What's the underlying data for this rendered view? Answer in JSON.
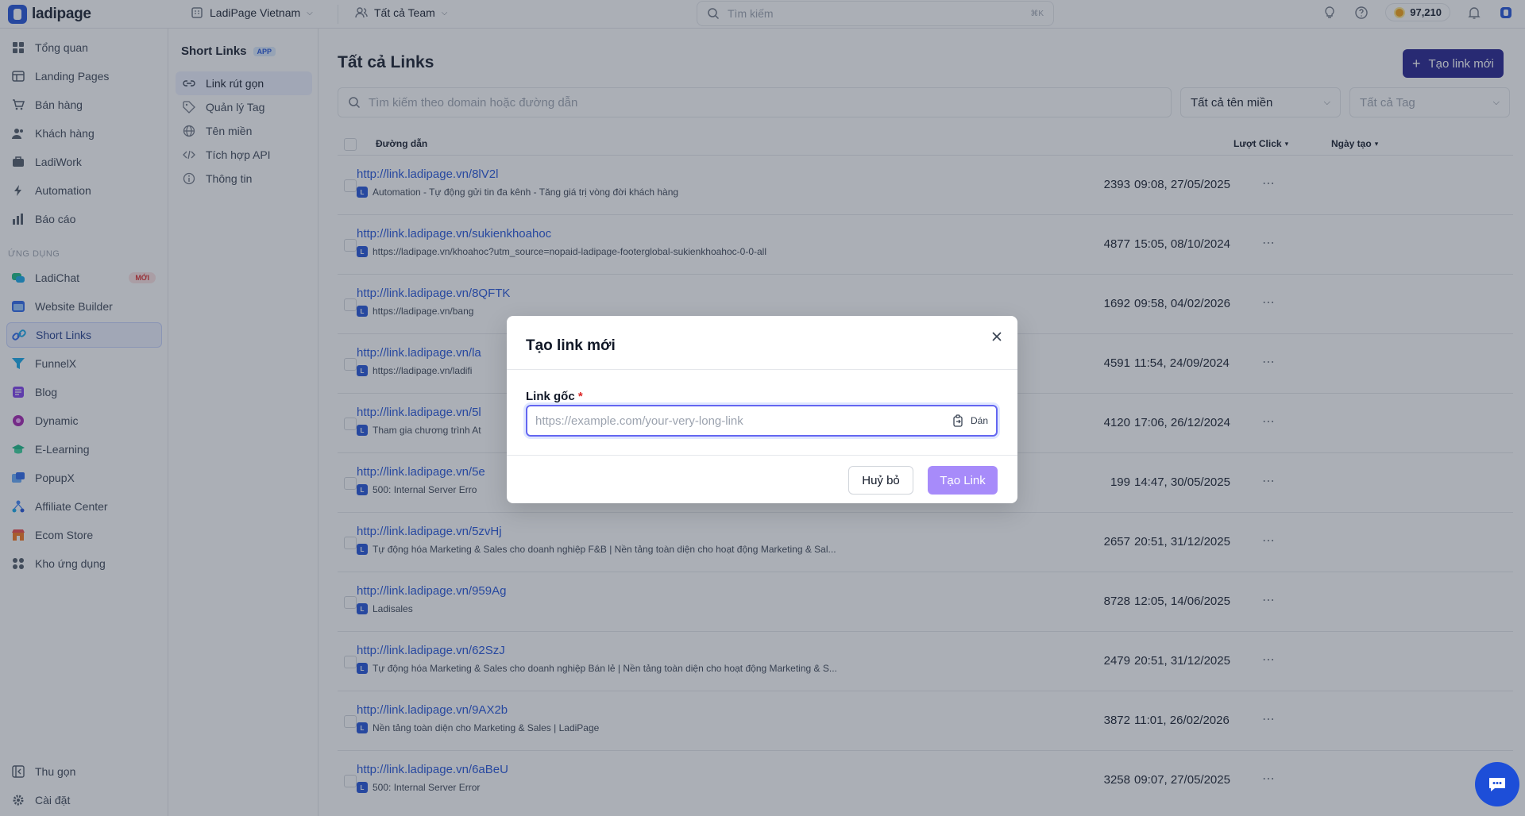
{
  "brand": {
    "name": "ladipage"
  },
  "topbar": {
    "workspace": "LadiPage Vietnam",
    "team": "Tất cả Team",
    "search_placeholder": "Tìm kiếm",
    "search_shortcut": "⌘K",
    "credits": "97,210"
  },
  "sidebar": {
    "items": [
      {
        "label": "Tổng quan",
        "icon": "grid-icon"
      },
      {
        "label": "Landing Pages",
        "icon": "layout-icon"
      },
      {
        "label": "Bán hàng",
        "icon": "cart-icon"
      },
      {
        "label": "Khách hàng",
        "icon": "users-icon"
      },
      {
        "label": "LadiWork",
        "icon": "briefcase-icon"
      },
      {
        "label": "Automation",
        "icon": "bolt-icon"
      },
      {
        "label": "Báo cáo",
        "icon": "bar-chart-icon"
      }
    ],
    "apps_label": "ỨNG DỤNG",
    "apps": [
      {
        "label": "LadiChat",
        "badge": "MỚI"
      },
      {
        "label": "Website Builder"
      },
      {
        "label": "Short Links",
        "active": true
      },
      {
        "label": "FunnelX"
      },
      {
        "label": "Blog"
      },
      {
        "label": "Dynamic"
      },
      {
        "label": "E-Learning"
      },
      {
        "label": "PopupX"
      },
      {
        "label": "Affiliate Center"
      },
      {
        "label": "Ecom Store"
      },
      {
        "label": "Kho ứng dụng"
      }
    ],
    "collapse": "Thu gọn",
    "settings": "Cài đặt"
  },
  "subsidebar": {
    "title": "Short Links",
    "badge": "APP",
    "items": [
      {
        "label": "Link rút gọn",
        "active": true
      },
      {
        "label": "Quản lý Tag"
      },
      {
        "label": "Tên miền"
      },
      {
        "label": "Tích hợp API"
      },
      {
        "label": "Thông tin"
      }
    ]
  },
  "main": {
    "title": "Tất cả Links",
    "new_button": "Tạo link mới",
    "search_placeholder": "Tìm kiếm theo domain hoặc đường dẫn",
    "domain_filter": "Tất cả tên miền",
    "tag_filter": "Tất cả Tag",
    "columns": {
      "path": "Đường dẫn",
      "clicks": "Lượt Click",
      "created": "Ngày tạo"
    },
    "rows": [
      {
        "url": "http://link.ladipage.vn/8lV2l",
        "desc": "Automation - Tự động gửi tin đa kênh - Tăng giá trị vòng đời khách hàng",
        "clicks": "2393",
        "date": "09:08, 27/05/2025"
      },
      {
        "url": "http://link.ladipage.vn/sukienkhoahoc",
        "desc": "https://ladipage.vn/khoahoc?utm_source=nopaid-ladipage-footerglobal-sukienkhoahoc-0-0-all",
        "clicks": "4877",
        "date": "15:05, 08/10/2024"
      },
      {
        "url": "http://link.ladipage.vn/8QFTK",
        "desc": "https://ladipage.vn/bang",
        "clicks": "1692",
        "date": "09:58, 04/02/2026"
      },
      {
        "url": "http://link.ladipage.vn/la",
        "desc": "https://ladipage.vn/ladifi",
        "clicks": "4591",
        "date": "11:54, 24/09/2024"
      },
      {
        "url": "http://link.ladipage.vn/5l",
        "desc": "Tham gia chương trình At",
        "clicks": "4120",
        "date": "17:06, 26/12/2024"
      },
      {
        "url": "http://link.ladipage.vn/5e",
        "desc": "500: Internal Server Erro",
        "clicks": "199",
        "date": "14:47, 30/05/2025"
      },
      {
        "url": "http://link.ladipage.vn/5zvHj",
        "desc": "Tự động hóa Marketing & Sales cho doanh nghiệp F&B | Nền tảng toàn diện cho hoạt động Marketing & Sal...",
        "clicks": "2657",
        "date": "20:51, 31/12/2025"
      },
      {
        "url": "http://link.ladipage.vn/959Ag",
        "desc": "Ladisales",
        "clicks": "8728",
        "date": "12:05, 14/06/2025"
      },
      {
        "url": "http://link.ladipage.vn/62SzJ",
        "desc": "Tự động hóa Marketing & Sales cho doanh nghiệp Bán lẻ | Nền tảng toàn diện cho hoạt động Marketing & S...",
        "clicks": "2479",
        "date": "20:51, 31/12/2025"
      },
      {
        "url": "http://link.ladipage.vn/9AX2b",
        "desc": "Nền tảng toàn diện cho Marketing & Sales | LadiPage",
        "clicks": "3872",
        "date": "11:01, 26/02/2026"
      },
      {
        "url": "http://link.ladipage.vn/6aBeU",
        "desc": "500: Internal Server Error",
        "clicks": "3258",
        "date": "09:07, 27/05/2025"
      }
    ]
  },
  "modal": {
    "title": "Tạo link mới",
    "field_label": "Link gốc",
    "required_mark": "*",
    "placeholder": "https://example.com/your-very-long-link",
    "paste_label": "Dán",
    "cancel": "Huỷ bỏ",
    "submit": "Tạo Link"
  },
  "colors": {
    "brand": "#1d4ed8",
    "primary_dark": "#1e1b8c",
    "submit_disabled": "#a78bfa",
    "link": "#1d4ed8"
  }
}
